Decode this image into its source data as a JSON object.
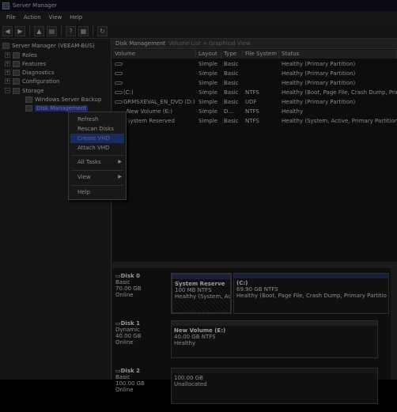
{
  "window": {
    "title": "Server Manager"
  },
  "menu": [
    "File",
    "Action",
    "View",
    "Help"
  ],
  "toolbar": [
    "back-icon",
    "forward-icon",
    "up-folder-icon",
    "show-tree-icon",
    "help-icon",
    "properties-icon",
    "refresh-icon"
  ],
  "tree": {
    "root": "Server Manager (VEEAM-BUS)",
    "roles": "Roles",
    "features": "Features",
    "diagnostics": "Diagnostics",
    "configuration": "Configuration",
    "storage": "Storage",
    "wsb": "Windows Server Backup",
    "disk_management": "Disk Management"
  },
  "main": {
    "header": "Disk Management",
    "header_sub": "Volume List + Graphical View",
    "columns": [
      "Volume",
      "Layout",
      "Type",
      "File System",
      "Status"
    ],
    "volumes": [
      {
        "name": "",
        "layout": "Simple",
        "type": "Basic",
        "fs": "",
        "status": "Healthy (Primary Partition)"
      },
      {
        "name": "",
        "layout": "Simple",
        "type": "Basic",
        "fs": "",
        "status": "Healthy (Primary Partition)"
      },
      {
        "name": "",
        "layout": "Simple",
        "type": "Basic",
        "fs": "",
        "status": "Healthy (Primary Partition)"
      },
      {
        "name": "(C:)",
        "layout": "Simple",
        "type": "Basic",
        "fs": "NTFS",
        "status": "Healthy (Boot, Page File, Crash Dump, Prima"
      },
      {
        "name": "GRMSXEVAL_EN_DVD (D:)",
        "layout": "Simple",
        "type": "Basic",
        "fs": "UDF",
        "status": "Healthy (Primary Partition)"
      },
      {
        "name": "New Volume (E:)",
        "layout": "Simple",
        "type": "D...",
        "fs": "NTFS",
        "status": "Healthy"
      },
      {
        "name": "System Reserved",
        "layout": "Simple",
        "type": "Basic",
        "fs": "NTFS",
        "status": "Healthy (System, Active, Primary Partition)"
      }
    ]
  },
  "disks": [
    {
      "name": "Disk 0",
      "type": "Basic",
      "size": "70.00 GB",
      "state": "Online",
      "partitions": [
        {
          "title": "System Reserve",
          "l1": "100 MB NTFS",
          "l2": "Healthy (System, Ac"
        },
        {
          "title": "(C:)",
          "l1": "69.90 GB NTFS",
          "l2": "Healthy (Boot, Page File, Crash Dump, Primary Partitio"
        }
      ]
    },
    {
      "name": "Disk 1",
      "type": "Dynamic",
      "size": "40.00 GB",
      "state": "Online",
      "partitions": [
        {
          "title": "New Volume  (E:)",
          "l1": "40.00 GB NTFS",
          "l2": "Healthy"
        }
      ]
    },
    {
      "name": "Disk 2",
      "type": "Basic",
      "size": "100.00 GB",
      "state": "Online",
      "partitions": [
        {
          "title": "",
          "l1": "100.00 GB",
          "l2": "Unallocated"
        }
      ]
    }
  ],
  "context_menu": {
    "refresh": "Refresh",
    "rescan": "Rescan Disks",
    "create_vhd": "Create VHD",
    "attach_vhd": "Attach VHD",
    "all_tasks": "All Tasks",
    "view": "View",
    "help": "Help"
  }
}
